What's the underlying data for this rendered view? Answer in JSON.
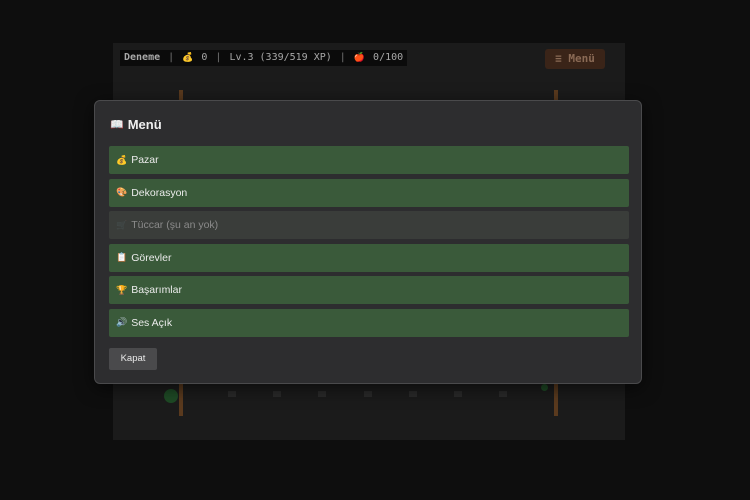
{
  "hud": {
    "farm_name": "Deneme",
    "sep": "|",
    "coin_icon": "money-bag-icon",
    "coin_glyph": "💰",
    "coins": "0",
    "level_text": "Lv.3 (339/519 XP)",
    "energy_icon": "apple-icon",
    "energy_glyph": "🍎",
    "energy": "0/100"
  },
  "top_menu_button": {
    "icon": "hamburger-icon",
    "label": "≡ Menü"
  },
  "modal": {
    "title_icon": "book-icon",
    "title_glyph": "📖",
    "title": "Menü",
    "items": [
      {
        "icon": "money-bag-icon",
        "glyph": "💰",
        "label": "Pazar",
        "enabled": true
      },
      {
        "icon": "palette-icon",
        "glyph": "🎨",
        "label": "Dekorasyon",
        "enabled": true
      },
      {
        "icon": "merchant-icon",
        "glyph": "🛒",
        "label": "Tüccar (şu an yok)",
        "enabled": false
      },
      {
        "icon": "scroll-icon",
        "glyph": "📋",
        "label": "Görevler",
        "enabled": true
      },
      {
        "icon": "trophy-icon",
        "glyph": "🏆",
        "label": "Başarımlar",
        "enabled": true
      },
      {
        "icon": "speaker-icon",
        "glyph": "🔊",
        "label": "Ses Açık",
        "enabled": true
      }
    ],
    "close_label": "Kapat"
  },
  "colors": {
    "menu_item_bg": "#3a5a3a",
    "menu_item_disabled_bg": "#3a3d3a",
    "modal_bg": "#2d2d2f",
    "top_menu_bg": "#3a2418"
  }
}
